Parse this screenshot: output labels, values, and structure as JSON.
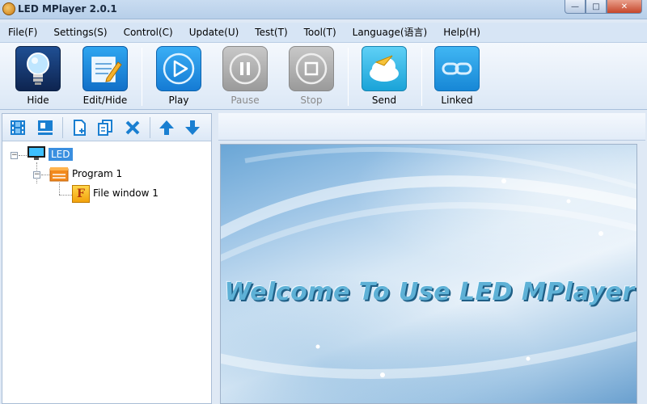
{
  "window": {
    "title": "LED MPlayer 2.0.1",
    "min_glyph": "—",
    "max_glyph": "□",
    "close_glyph": "✕"
  },
  "menu": [
    {
      "id": "file",
      "label": "File(F)"
    },
    {
      "id": "settings",
      "label": "Settings(S)"
    },
    {
      "id": "control",
      "label": "Control(C)"
    },
    {
      "id": "update",
      "label": "Update(U)"
    },
    {
      "id": "test",
      "label": "Test(T)"
    },
    {
      "id": "tool",
      "label": "Tool(T)"
    },
    {
      "id": "language",
      "label": "Language(语言)"
    },
    {
      "id": "help",
      "label": "Help(H)"
    }
  ],
  "toolbar": {
    "hide": "Hide",
    "edit_hide": "Edit/Hide",
    "play": "Play",
    "pause": "Pause",
    "stop": "Stop",
    "send": "Send",
    "linked": "Linked"
  },
  "tree": {
    "led": "LED",
    "program": "Program 1",
    "file_window": "File window 1",
    "file_window_badge": "F"
  },
  "preview": {
    "welcome": "Welcome To Use LED MPlayer"
  },
  "colors": {
    "accent_blue": "#3a8fe0",
    "menubar_bg": "#d7e5f5",
    "disabled_text": "#8b8b8b"
  }
}
